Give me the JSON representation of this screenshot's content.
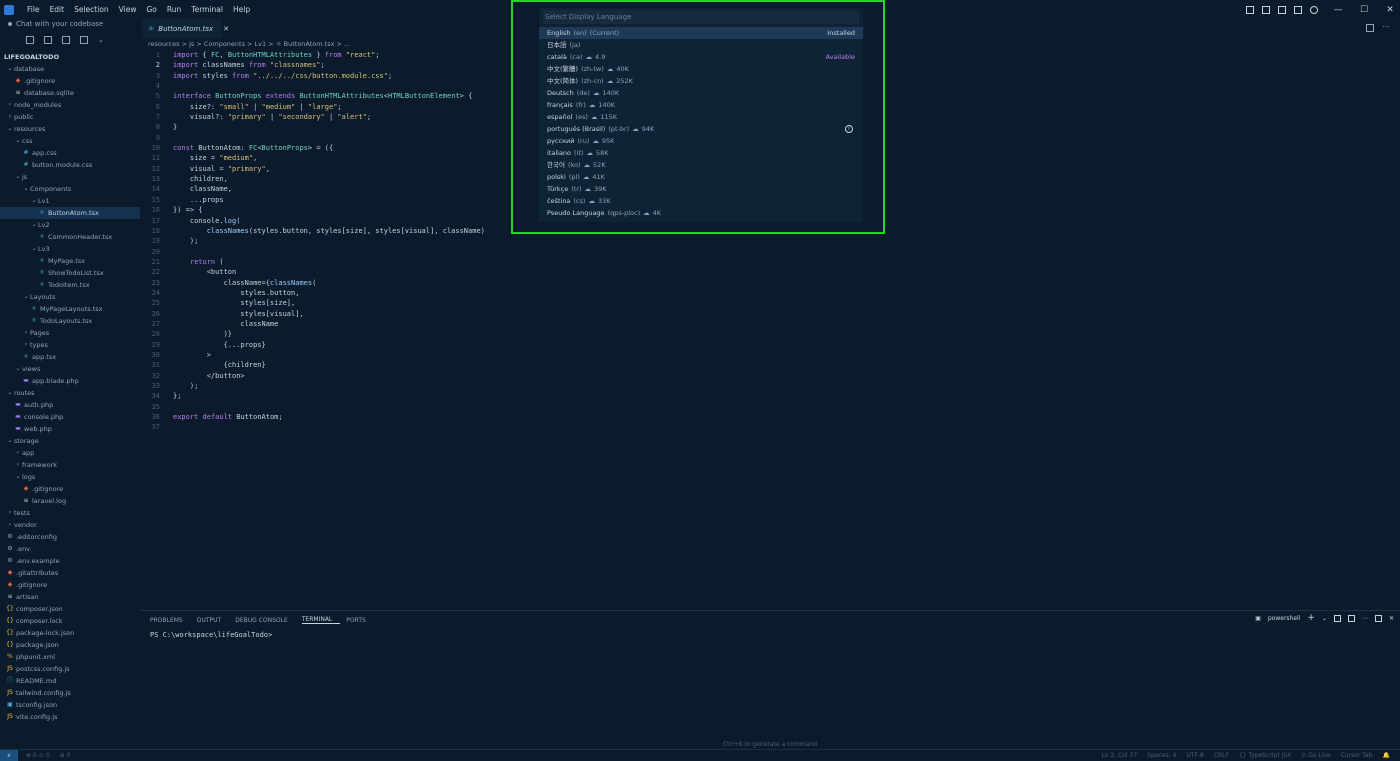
{
  "titlebar": {
    "menu": [
      "File",
      "Edit",
      "Selection",
      "View",
      "Go",
      "Run",
      "Terminal",
      "Help"
    ]
  },
  "sidebar": {
    "chat": "Chat with your codebase",
    "root": "LIFEGOALTODO",
    "items": [
      {
        "label": "database",
        "depth": 0,
        "type": "folder-open"
      },
      {
        "label": ".gitignore",
        "depth": 1,
        "type": "git"
      },
      {
        "label": "database.sqlite",
        "depth": 1,
        "type": "db"
      },
      {
        "label": "node_modules",
        "depth": 0,
        "type": "folder"
      },
      {
        "label": "public",
        "depth": 0,
        "type": "folder"
      },
      {
        "label": "resources",
        "depth": 0,
        "type": "folder-open"
      },
      {
        "label": "css",
        "depth": 1,
        "type": "folder-open"
      },
      {
        "label": "app.css",
        "depth": 2,
        "type": "css"
      },
      {
        "label": "button.module.css",
        "depth": 2,
        "type": "css"
      },
      {
        "label": "js",
        "depth": 1,
        "type": "folder-open"
      },
      {
        "label": "Components",
        "depth": 2,
        "type": "folder-open"
      },
      {
        "label": "Lv1",
        "depth": 3,
        "type": "folder-open"
      },
      {
        "label": "ButtonAtom.tsx",
        "depth": 4,
        "type": "tsx",
        "selected": true
      },
      {
        "label": "Lv2",
        "depth": 3,
        "type": "folder-open"
      },
      {
        "label": "CommonHeader.tsx",
        "depth": 4,
        "type": "tsx"
      },
      {
        "label": "Lv3",
        "depth": 3,
        "type": "folder-open"
      },
      {
        "label": "MyPage.tsx",
        "depth": 4,
        "type": "tsx"
      },
      {
        "label": "ShowTodoList.tsx",
        "depth": 4,
        "type": "tsx"
      },
      {
        "label": "TodoItem.tsx",
        "depth": 4,
        "type": "tsx"
      },
      {
        "label": "Layouts",
        "depth": 2,
        "type": "folder-open"
      },
      {
        "label": "MyPageLayouts.tsx",
        "depth": 3,
        "type": "tsx"
      },
      {
        "label": "TodoLayouts.tsx",
        "depth": 3,
        "type": "tsx"
      },
      {
        "label": "Pages",
        "depth": 2,
        "type": "folder"
      },
      {
        "label": "types",
        "depth": 2,
        "type": "folder"
      },
      {
        "label": "app.tsx",
        "depth": 2,
        "type": "tsx"
      },
      {
        "label": "views",
        "depth": 1,
        "type": "folder-open"
      },
      {
        "label": "app.blade.php",
        "depth": 2,
        "type": "php"
      },
      {
        "label": "routes",
        "depth": 0,
        "type": "folder-open"
      },
      {
        "label": "auth.php",
        "depth": 1,
        "type": "php"
      },
      {
        "label": "console.php",
        "depth": 1,
        "type": "php"
      },
      {
        "label": "web.php",
        "depth": 1,
        "type": "php"
      },
      {
        "label": "storage",
        "depth": 0,
        "type": "folder-open"
      },
      {
        "label": "app",
        "depth": 1,
        "type": "folder"
      },
      {
        "label": "framework",
        "depth": 1,
        "type": "folder"
      },
      {
        "label": "logs",
        "depth": 1,
        "type": "folder-open"
      },
      {
        "label": ".gitignore",
        "depth": 2,
        "type": "git"
      },
      {
        "label": "laravel.log",
        "depth": 2,
        "type": "log"
      },
      {
        "label": "tests",
        "depth": 0,
        "type": "folder"
      },
      {
        "label": "vendor",
        "depth": 0,
        "type": "folder"
      },
      {
        "label": ".editorconfig",
        "depth": 0,
        "type": "gear"
      },
      {
        "label": ".env",
        "depth": 0,
        "type": "gear"
      },
      {
        "label": ".env.example",
        "depth": 0,
        "type": "gear"
      },
      {
        "label": ".gitattributes",
        "depth": 0,
        "type": "git"
      },
      {
        "label": ".gitignore",
        "depth": 0,
        "type": "git"
      },
      {
        "label": "artisan",
        "depth": 0,
        "type": "file"
      },
      {
        "label": "composer.json",
        "depth": 0,
        "type": "json"
      },
      {
        "label": "composer.lock",
        "depth": 0,
        "type": "json"
      },
      {
        "label": "package-lock.json",
        "depth": 0,
        "type": "json"
      },
      {
        "label": "package.json",
        "depth": 0,
        "type": "json"
      },
      {
        "label": "phpunit.xml",
        "depth": 0,
        "type": "xml"
      },
      {
        "label": "postcss.config.js",
        "depth": 0,
        "type": "js"
      },
      {
        "label": "README.md",
        "depth": 0,
        "type": "md"
      },
      {
        "label": "tailwind.config.js",
        "depth": 0,
        "type": "js"
      },
      {
        "label": "tsconfig.json",
        "depth": 0,
        "type": "ts"
      },
      {
        "label": "vite.config.js",
        "depth": 0,
        "type": "js"
      }
    ]
  },
  "editor": {
    "tab_label": "ButtonAtom.tsx",
    "breadcrumb": "resources > js > Components > Lv1 > ⚛ ButtonAtom.tsx > ...",
    "current_line": 2,
    "lines": [
      "import { FC, ButtonHTMLAttributes } from \"react\";",
      "import classNames from \"classnames\";",
      "import styles from \"../../../css/button.module.css\";",
      "",
      "interface ButtonProps extends ButtonHTMLAttributes<HTMLButtonElement> {",
      "    size?: \"small\" | \"medium\" | \"large\";",
      "    visual?: \"primary\" | \"secondary\" | \"alert\";",
      "}",
      "",
      "const ButtonAtom: FC<ButtonProps> = ({",
      "    size = \"medium\",",
      "    visual = \"primary\",",
      "    children,",
      "    className,",
      "    ...props",
      "}) => {",
      "    console.log(",
      "        classNames(styles.button, styles[size], styles[visual], className)",
      "    );",
      "",
      "    return (",
      "        <button",
      "            className={classNames(",
      "                styles.button,",
      "                styles[size],",
      "                styles[visual],",
      "                className",
      "            )}",
      "            {...props}",
      "        >",
      "            {children}",
      "        </button>",
      "    );",
      "};",
      "",
      "export default ButtonAtom;",
      ""
    ]
  },
  "quickpick": {
    "placeholder": "Select Display Language",
    "items": [
      {
        "name": "English",
        "code": "(en)",
        "extra": "(Current)",
        "downloads": "",
        "tag": "Installed",
        "selected": true
      },
      {
        "name": "日本語",
        "code": "(ja)",
        "extra": "",
        "downloads": "",
        "tag": "",
        "selected": false
      },
      {
        "name": "català",
        "code": "(ca)",
        "extra": "",
        "downloads": "4.9",
        "tag": "Available",
        "selected": false
      },
      {
        "name": "中文(繁體)",
        "code": "(zh-tw)",
        "extra": "",
        "downloads": "40K",
        "tag": "",
        "selected": false
      },
      {
        "name": "中文(简体)",
        "code": "(zh-cn)",
        "extra": "",
        "downloads": "252K",
        "tag": "",
        "selected": false
      },
      {
        "name": "Deutsch",
        "code": "(de)",
        "extra": "",
        "downloads": "140K",
        "tag": "",
        "selected": false
      },
      {
        "name": "français",
        "code": "(fr)",
        "extra": "",
        "downloads": "140K",
        "tag": "",
        "selected": false
      },
      {
        "name": "español",
        "code": "(es)",
        "extra": "",
        "downloads": "115K",
        "tag": "",
        "selected": false
      },
      {
        "name": "português (Brasil)",
        "code": "(pt-br)",
        "extra": "",
        "downloads": "94K",
        "tag": "",
        "selected": false,
        "info": true
      },
      {
        "name": "русский",
        "code": "(ru)",
        "extra": "",
        "downloads": "95K",
        "tag": "",
        "selected": false
      },
      {
        "name": "italiano",
        "code": "(it)",
        "extra": "",
        "downloads": "58K",
        "tag": "",
        "selected": false
      },
      {
        "name": "한국어",
        "code": "(ko)",
        "extra": "",
        "downloads": "52K",
        "tag": "",
        "selected": false
      },
      {
        "name": "polski",
        "code": "(pl)",
        "extra": "",
        "downloads": "41K",
        "tag": "",
        "selected": false
      },
      {
        "name": "Türkçe",
        "code": "(tr)",
        "extra": "",
        "downloads": "39K",
        "tag": "",
        "selected": false
      },
      {
        "name": "čeština",
        "code": "(cs)",
        "extra": "",
        "downloads": "33K",
        "tag": "",
        "selected": false
      },
      {
        "name": "Pseudo Language",
        "code": "(qps-ploc)",
        "extra": "",
        "downloads": "4K",
        "tag": "",
        "selected": false
      }
    ]
  },
  "panel": {
    "tabs": [
      "PROBLEMS",
      "OUTPUT",
      "DEBUG CONSOLE",
      "TERMINAL",
      "PORTS"
    ],
    "active_tab": "TERMINAL",
    "terminal_name": "powershell",
    "prompt": "PS C:\\workspace\\lifeGoalTodo> ",
    "chat_hint": "Ctrl+K to generate a command"
  },
  "statusbar": {
    "left": [
      "⊗ 0 ⚠ 0",
      "⊕ 0"
    ],
    "right": [
      "Ln 2, Col 37",
      "Spaces: 4",
      "UTF-8",
      "CRLF",
      "{} TypeScript JSX",
      "⊙ Go Live",
      "Cursor Tab",
      "🔔"
    ]
  },
  "colors": {
    "accent": "#25d32a",
    "background": "#0b1b2b"
  }
}
